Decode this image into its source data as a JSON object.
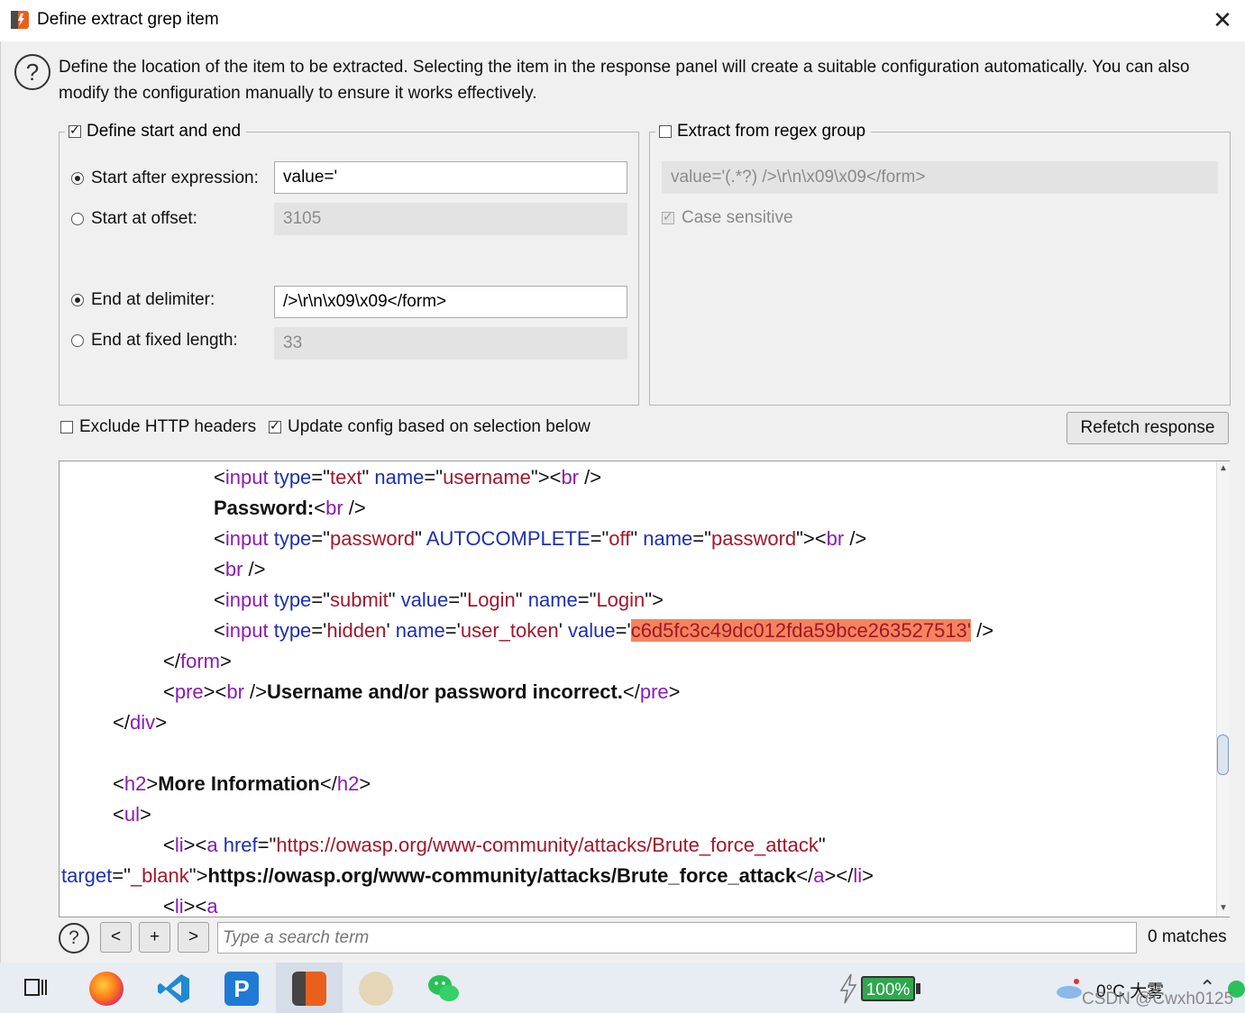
{
  "window": {
    "title": "Define extract grep item",
    "close_glyph": "✕"
  },
  "help": {
    "glyph": "?",
    "description": "Define the location of the item to be extracted. Selecting the item in the response panel will create a suitable configuration automatically. You can also modify the configuration manually to ensure it works effectively."
  },
  "start_end": {
    "legend": "Define start and end",
    "checked": true,
    "start_after_label": "Start after expression:",
    "start_after_value": "value='",
    "start_offset_label": "Start at offset:",
    "start_offset_value": "3105",
    "end_delim_label": "End at delimiter:",
    "end_delim_value": "/>\\r\\n\\x09\\x09</form>",
    "end_fixed_label": "End at fixed length:",
    "end_fixed_value": "33"
  },
  "regex": {
    "legend": "Extract from regex group",
    "checked": false,
    "expression": "value='(.*?) />\\r\\n\\x09\\x09</form>",
    "case_label": "Case sensitive",
    "case_checked": true
  },
  "options": {
    "exclude_headers_label": "Exclude HTTP headers",
    "exclude_headers_checked": false,
    "update_config_label": "Update config based on selection below",
    "update_config_checked": true,
    "refetch_label": "Refetch response"
  },
  "code": {
    "l1": {
      "a": "<",
      "b": "input",
      "c": " ",
      "d": "type",
      "e": "=\"",
      "f": "text",
      "g": "\" ",
      "h": "name",
      "i": "=\"",
      "j": "username",
      "k": "\"><",
      "l": "br",
      "m": " />"
    },
    "l2": {
      "a": "Password:",
      "b": "<",
      "c": "br",
      "d": " />"
    },
    "l3": {
      "a": "<",
      "b": "input",
      "c": " ",
      "d": "type",
      "e": "=\"",
      "f": "password",
      "g": "\" ",
      "h": "AUTOCOMPLETE",
      "i": "=\"",
      "j": "off",
      "k": "\" ",
      "l": "name",
      "m": "=\"",
      "n": "password",
      "o": "\"><",
      "p": "br",
      "q": " />"
    },
    "l4": {
      "a": "<",
      "b": "br",
      "c": " />"
    },
    "l5": {
      "a": "<",
      "b": "input",
      "c": " ",
      "d": "type",
      "e": "=\"",
      "f": "submit",
      "g": "\" ",
      "h": "value",
      "i": "=\"",
      "j": "Login",
      "k": "\" ",
      "l": "name",
      "m": "=\"",
      "n": "Login",
      "o": "\">"
    },
    "l6": {
      "a": "<",
      "b": "input",
      "c": " ",
      "d": "type",
      "e": "='",
      "f": "hidden",
      "g": "' ",
      "h": "name",
      "i": "='",
      "j": "user_token",
      "k": "' ",
      "l": "value",
      "m": "='",
      "n": "c6d5fc3c49dc012fda59bce263527513'",
      "o": " />"
    },
    "l7": {
      "a": "</",
      "b": "form",
      "c": ">"
    },
    "l8": {
      "a": "<",
      "b": "pre",
      "c": "><",
      "d": "br",
      "e": " />",
      "f": "Username and/or password incorrect.",
      "g": "</",
      "h": "pre",
      "i": ">"
    },
    "l9": {
      "a": "</",
      "b": "div",
      "c": ">"
    },
    "l10": {
      "a": "<",
      "b": "h2",
      "c": ">",
      "d": "More Information",
      "e": "</",
      "f": "h2",
      "g": ">"
    },
    "l11": {
      "a": "<",
      "b": "ul",
      "c": ">"
    },
    "l12": {
      "a": "<",
      "b": "li",
      "c": "><",
      "d": "a",
      "e": " ",
      "f": "href",
      "g": "=\"",
      "h": "https://owasp.org/www-community/attacks/Brute_force_attack",
      "i": "\""
    },
    "l13": {
      "a": "target",
      "b": "=\"",
      "c": "_blank",
      "d": "\">",
      "e": "https://owasp.org/www-community/attacks/Brute_force_attack",
      "f": "</",
      "g": "a",
      "h": "></",
      "i": "li",
      "j": ">"
    },
    "l14": {
      "a": "<",
      "b": "li",
      "c": "><",
      "d": "a"
    }
  },
  "search": {
    "help_glyph": "?",
    "prev": "<",
    "add": "+",
    "next": ">",
    "placeholder": "Type a search term",
    "matches": "0 matches"
  },
  "taskbar": {
    "battery": "100%",
    "weather": "0°C  大雾",
    "watermark": "CSDN @Cwxh0125"
  }
}
